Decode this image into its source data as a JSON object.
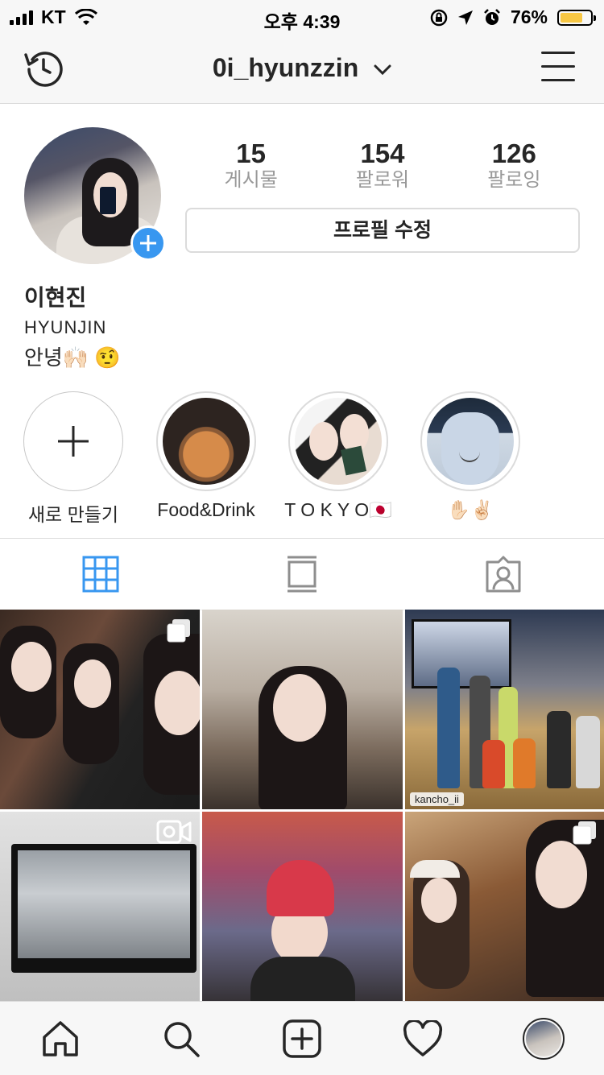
{
  "status_bar": {
    "carrier": "KT",
    "time": "오후 4:39",
    "battery_percent_text": "76%",
    "battery_level": 0.76,
    "battery_color": "#f7c744"
  },
  "header": {
    "username": "0i_hyunzzin",
    "history_icon": "history-icon",
    "menu_icon": "hamburger-menu-icon"
  },
  "profile": {
    "stats": [
      {
        "count": "15",
        "label": "게시물"
      },
      {
        "count": "154",
        "label": "팔로워"
      },
      {
        "count": "126",
        "label": "팔로잉"
      }
    ],
    "edit_button": "프로필 수정",
    "full_name": "이현진",
    "bio_line1": "HYUNJIN",
    "bio_line2": "안녕🙌🏻 🤨",
    "accent_color": "#3897f0"
  },
  "highlights": [
    {
      "label": "새로 만들기"
    },
    {
      "label": "Food&Drink"
    },
    {
      "label": "T O K Y O🇯🇵"
    },
    {
      "label": "✋🏻✌🏻"
    }
  ],
  "tabs": [
    {
      "icon": "grid-icon",
      "active": true
    },
    {
      "icon": "feed-list-icon",
      "active": false
    },
    {
      "icon": "tagged-person-icon",
      "active": false
    }
  ],
  "posts": [
    {
      "type": "carousel"
    },
    {
      "type": "photo"
    },
    {
      "type": "photo",
      "credit": "kancho_ii"
    },
    {
      "type": "video"
    },
    {
      "type": "photo"
    },
    {
      "type": "carousel"
    }
  ],
  "bottom_nav": [
    {
      "icon": "home-icon"
    },
    {
      "icon": "search-icon"
    },
    {
      "icon": "add-post-icon"
    },
    {
      "icon": "heart-icon"
    },
    {
      "icon": "profile-avatar-icon"
    }
  ]
}
